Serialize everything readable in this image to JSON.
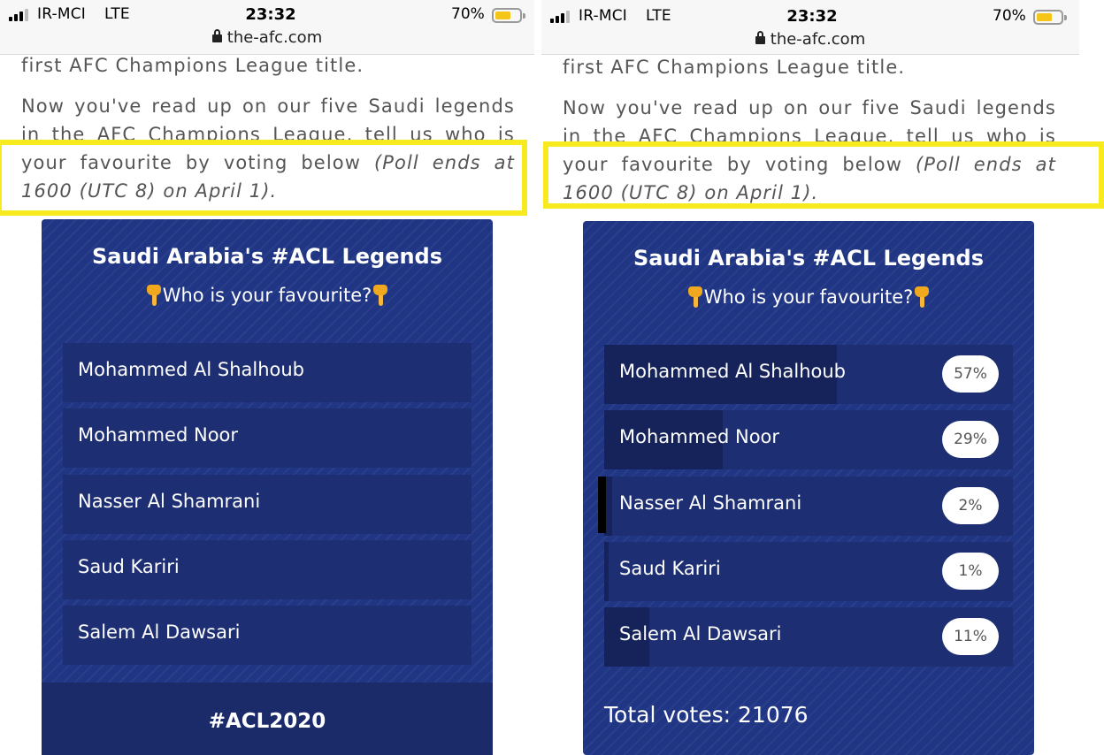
{
  "status_bar": {
    "carrier": "IR-MCI",
    "network": "LTE",
    "time": "23:32",
    "battery_percent": "70%",
    "battery_level": 0.7,
    "url": "the-afc.com"
  },
  "article": {
    "line1": "first AFC Champions League title.",
    "line2": [
      "Now",
      "you've",
      "read",
      "up",
      "on",
      "our",
      "five",
      "Saudi",
      "legends"
    ],
    "line3": [
      "in",
      "the",
      "AFC",
      "Champions",
      "League,",
      "tell",
      "us",
      "who",
      "is"
    ],
    "line4_words": [
      "your",
      "favourite",
      "by",
      "voting",
      "below"
    ],
    "line4_italic": [
      "(Poll",
      "ends",
      "at"
    ],
    "line5": "1600 (UTC 8) on April 1)."
  },
  "poll": {
    "title": "Saudi Arabia's #ACL Legends",
    "subtitle": "Who is your favourite?",
    "options": [
      {
        "name": "Mohammed Al Shalhoub",
        "percent": "57%",
        "share": 0.57
      },
      {
        "name": "Mohammed Noor",
        "percent": "29%",
        "share": 0.29
      },
      {
        "name": "Nasser Al Shamrani",
        "percent": "2%",
        "share": 0.02
      },
      {
        "name": "Saud Kariri",
        "percent": "1%",
        "share": 0.01
      },
      {
        "name": "Salem Al Dawsari",
        "percent": "11%",
        "share": 0.11
      }
    ],
    "hashtag": "#ACL2020",
    "total_votes": "Total votes: 21076"
  },
  "colors": {
    "card": "#203684",
    "option_bg": "#1d2f72",
    "result_bar": "#15235a",
    "highlight": "#f7ea1e",
    "battery": "#f5c518"
  }
}
